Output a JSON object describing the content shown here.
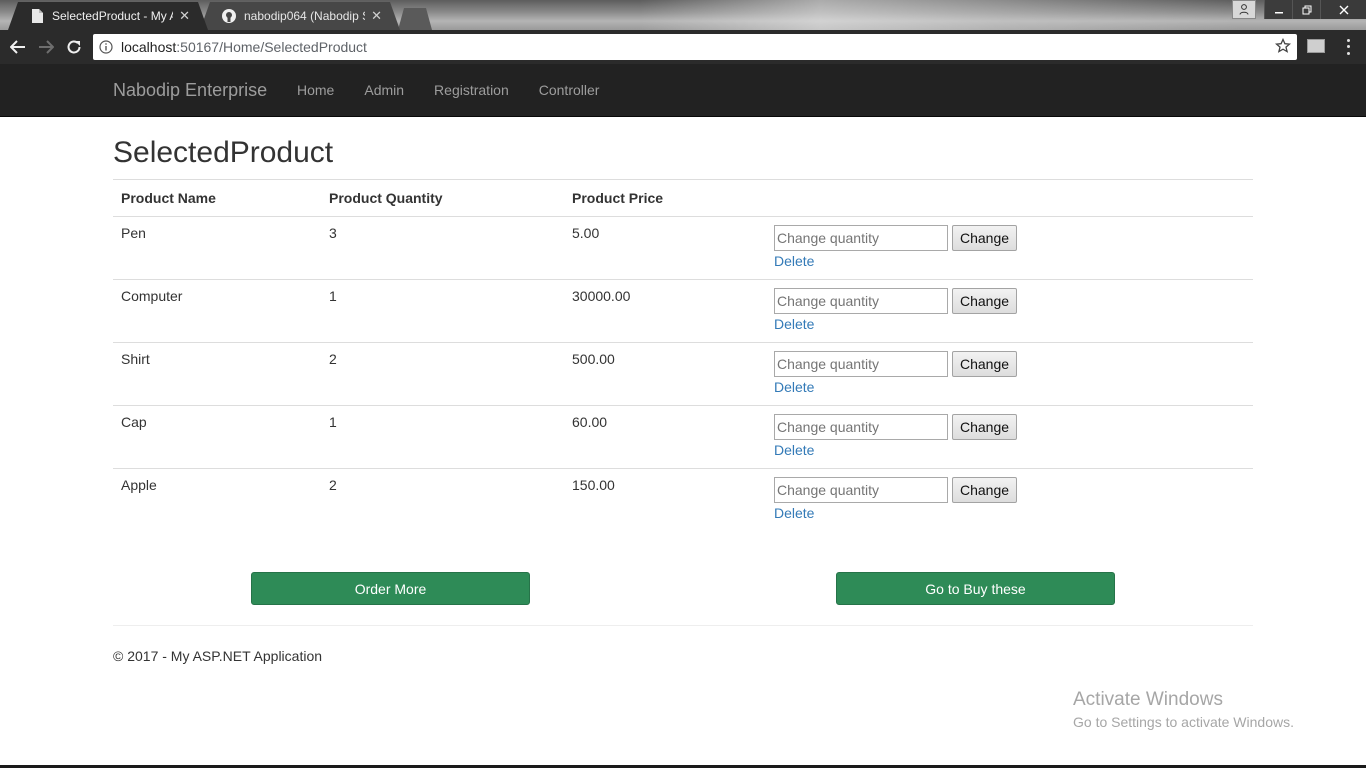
{
  "browser": {
    "tabs": [
      {
        "title": "SelectedProduct - My AS",
        "icon": "page-icon"
      },
      {
        "title": "nabodip064 (Nabodip Su",
        "icon": "github-icon"
      }
    ],
    "address": {
      "host": "localhost",
      "path": ":50167/Home/SelectedProduct"
    }
  },
  "navbar": {
    "brand": "Nabodip Enterprise",
    "links": [
      "Home",
      "Admin",
      "Registration",
      "Controller"
    ]
  },
  "page": {
    "title": "SelectedProduct",
    "table": {
      "headers": [
        "Product Name",
        "Product Quantity",
        "Product Price"
      ],
      "rows": [
        {
          "name": "Pen",
          "quantity": "3",
          "price": "5.00"
        },
        {
          "name": "Computer",
          "quantity": "1",
          "price": "30000.00"
        },
        {
          "name": "Shirt",
          "quantity": "2",
          "price": "500.00"
        },
        {
          "name": "Cap",
          "quantity": "1",
          "price": "60.00"
        },
        {
          "name": "Apple",
          "quantity": "2",
          "price": "150.00"
        }
      ],
      "quantity_placeholder": "Change quantity",
      "change_label": "Change",
      "delete_label": "Delete"
    },
    "buttons": {
      "order_more": "Order More",
      "buy_these": "Go to Buy these"
    },
    "footer": "© 2017 - My ASP.NET Application"
  },
  "watermark": {
    "line1": "Activate Windows",
    "line2": "Go to Settings to activate Windows."
  },
  "colors": {
    "navbar_bg": "#222222",
    "navbar_text": "#9d9d9d",
    "action_button": "#2e8b57",
    "link": "#337ab7"
  }
}
